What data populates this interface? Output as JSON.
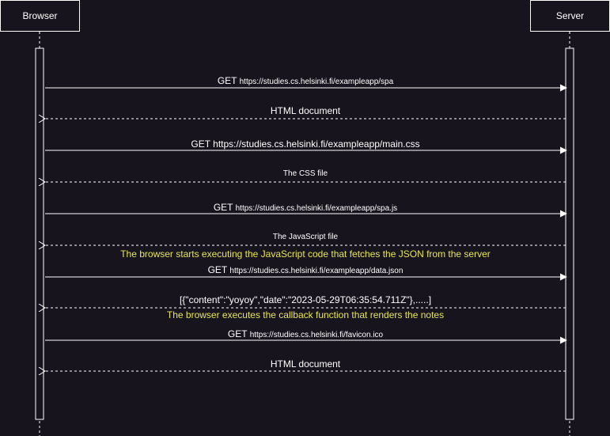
{
  "participants": {
    "browser": "Browser",
    "server": "Server"
  },
  "colors": {
    "background": "#18141d",
    "line": "#ffffff",
    "note": "#e6e65a"
  },
  "messages": [
    {
      "method": "GET",
      "text": "https://studies.cs.helsinki.fi/exampleapp/spa",
      "dir": "right",
      "style": "solid"
    },
    {
      "method": "",
      "text": "HTML document",
      "dir": "left",
      "style": "dashed"
    },
    {
      "method": "",
      "text": "GET https://studies.cs.helsinki.fi/exampleapp/main.css",
      "dir": "right",
      "style": "solid"
    },
    {
      "method": "",
      "text": "The CSS file",
      "dir": "left",
      "style": "dashed"
    },
    {
      "method": "GET",
      "text": "https://studies.cs.helsinki.fi/exampleapp/spa.js",
      "dir": "right",
      "style": "solid"
    },
    {
      "method": "",
      "text": "The JavaScript file",
      "dir": "left",
      "style": "dashed"
    },
    {
      "method": "GET",
      "text": "https://studies.cs.helsinki.fi/exampleapp/data.json",
      "dir": "right",
      "style": "solid"
    },
    {
      "method": "",
      "text": "[{\"content\":\"yoyoy\",\"date\":\"2023-05-29T06:35:54.711Z\"},.....]",
      "dir": "left",
      "style": "dashed"
    },
    {
      "method": "GET",
      "text": "https://studies.cs.helsinki.fi/favicon.ico",
      "dir": "right",
      "style": "solid"
    },
    {
      "method": "",
      "text": "HTML document",
      "dir": "left",
      "style": "dashed"
    }
  ],
  "notes": [
    "The browser starts executing the JavaScript code that fetches the JSON from the server",
    "The browser executes the callback function that renders the notes"
  ]
}
